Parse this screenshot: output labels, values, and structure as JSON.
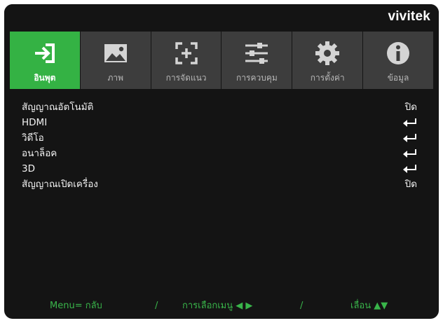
{
  "brand": {
    "logo_text": "vivitek"
  },
  "tabs": [
    {
      "label": "อินพุต",
      "icon": "input-icon",
      "active": true
    },
    {
      "label": "ภาพ",
      "icon": "picture-icon",
      "active": false
    },
    {
      "label": "การจัดแนว",
      "icon": "alignment-icon",
      "active": false
    },
    {
      "label": "การควบคุม",
      "icon": "sliders-icon",
      "active": false
    },
    {
      "label": "การตั้งค่า",
      "icon": "gear-icon",
      "active": false
    },
    {
      "label": "ข้อมูล",
      "icon": "info-icon",
      "active": false
    }
  ],
  "menu": {
    "items": [
      {
        "label": "สัญญาณอัตโนมัติ",
        "value": "ปิด"
      },
      {
        "label": "HDMI",
        "value_icon": "enter-icon"
      },
      {
        "label": "วิดีโอ",
        "value_icon": "enter-icon"
      },
      {
        "label": "อนาล็อค",
        "value_icon": "enter-icon"
      },
      {
        "label": "3D",
        "value_icon": "enter-icon"
      },
      {
        "label": "สัญญาณเปิดเครื่อง",
        "value": "ปิด"
      }
    ]
  },
  "footer": {
    "menu_back": "Menu= กลับ",
    "sep1": "/",
    "select_menu": "การเลือกเมนู ◀ ▶",
    "sep2": "/",
    "scroll": "เลื่อน ▲▼"
  },
  "colors": {
    "accent": "#34b244",
    "footer_text": "#39b54a",
    "tab_bg": "#3d3d3d",
    "frame_bg": "#141414"
  }
}
